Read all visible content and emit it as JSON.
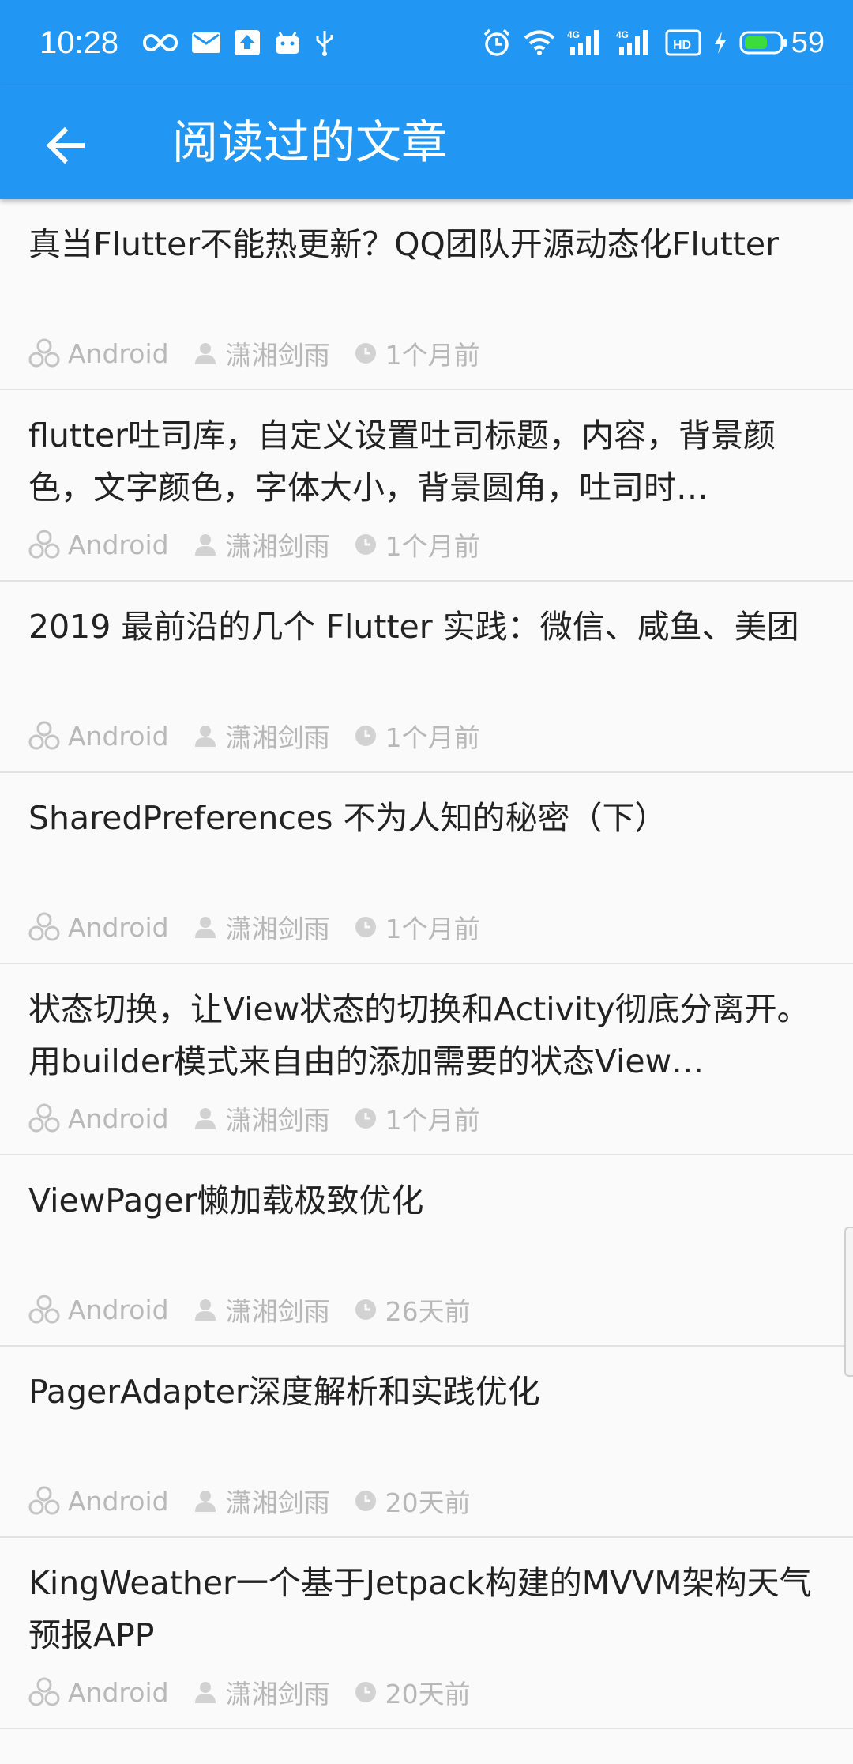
{
  "status_bar": {
    "time": "10:28",
    "left_icons": [
      "infinity-icon",
      "mail-icon",
      "upload-icon",
      "android-icon",
      "usb-icon"
    ],
    "right_icons": [
      "alarm-icon",
      "wifi-icon",
      "signal-4g-icon",
      "signal-4g-icon",
      "hd-icon",
      "charging-icon",
      "battery-icon"
    ],
    "network_label_1": "4G",
    "network_label_2": "4G",
    "hd_label": "HD",
    "battery": "59"
  },
  "app_bar": {
    "title": "阅读过的文章",
    "back_icon": "arrow-back-icon"
  },
  "colors": {
    "primary": "#2196f3",
    "meta_text": "#b8b8b8",
    "title_text": "#222222",
    "battery_fill": "#3ddc3d"
  },
  "articles": [
    {
      "title": "真当Flutter不能热更新？QQ团队开源动态化Flutter",
      "category": "Android",
      "author": "潇湘剑雨",
      "time": "1个月前"
    },
    {
      "title": "flutter吐司库，自定义设置吐司标题，内容，背景颜色，文字颜色，字体大小，背景圆角，吐司时…",
      "category": "Android",
      "author": "潇湘剑雨",
      "time": "1个月前"
    },
    {
      "title": "2019 最前沿的几个 Flutter 实践：微信、咸鱼、美团",
      "category": "Android",
      "author": "潇湘剑雨",
      "time": "1个月前"
    },
    {
      "title": "SharedPreferences 不为人知的秘密（下）",
      "category": "Android",
      "author": "潇湘剑雨",
      "time": "1个月前"
    },
    {
      "title": "状态切换，让View状态的切换和Activity彻底分离开。用builder模式来自由的添加需要的状态View…",
      "category": "Android",
      "author": "潇湘剑雨",
      "time": "1个月前"
    },
    {
      "title": "ViewPager懒加载极致优化",
      "category": "Android",
      "author": "潇湘剑雨",
      "time": "26天前"
    },
    {
      "title": "PagerAdapter深度解析和实践优化",
      "category": "Android",
      "author": "潇湘剑雨",
      "time": "20天前"
    },
    {
      "title": "KingWeather一个基于Jetpack构建的MVVM架构天气预报APP",
      "category": "Android",
      "author": "潇湘剑雨",
      "time": "20天前"
    }
  ]
}
